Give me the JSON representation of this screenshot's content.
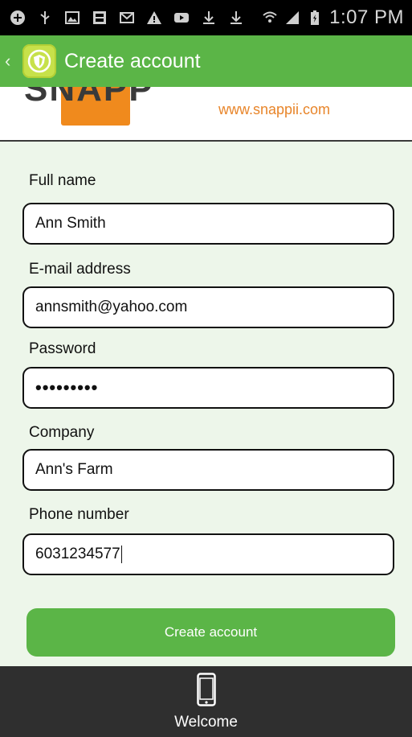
{
  "status_bar": {
    "time": "1:07 PM",
    "icons": [
      "add-circle-icon",
      "usb-icon",
      "image-icon",
      "snapp-icon",
      "gmail-icon",
      "warning-icon",
      "video-icon",
      "download-icon",
      "download-icon",
      "wifi-icon",
      "signal-icon",
      "battery-icon"
    ]
  },
  "action_bar": {
    "title": "Create account",
    "back_icon": "chevron-left-icon",
    "app_icon": "shield-app-icon"
  },
  "brand": {
    "logo_text": "SNAPP",
    "url": "www.snappii.com"
  },
  "form": {
    "fields": [
      {
        "label": "Full name",
        "value": "Ann Smith"
      },
      {
        "label": "E-mail address",
        "value": "annsmith@yahoo.com"
      },
      {
        "label": "Password",
        "value": "•••••••••"
      },
      {
        "label": "Company",
        "value": "Ann's Farm"
      },
      {
        "label": "Phone number",
        "value": "6031234577"
      }
    ],
    "submit_label": "Create account"
  },
  "tab_bar": {
    "items": [
      {
        "label": "Welcome",
        "icon": "phone-icon"
      }
    ]
  },
  "colors": {
    "accent_green": "#5bb547",
    "form_background": "#edf6ea",
    "brand_orange": "#f08a1d"
  }
}
